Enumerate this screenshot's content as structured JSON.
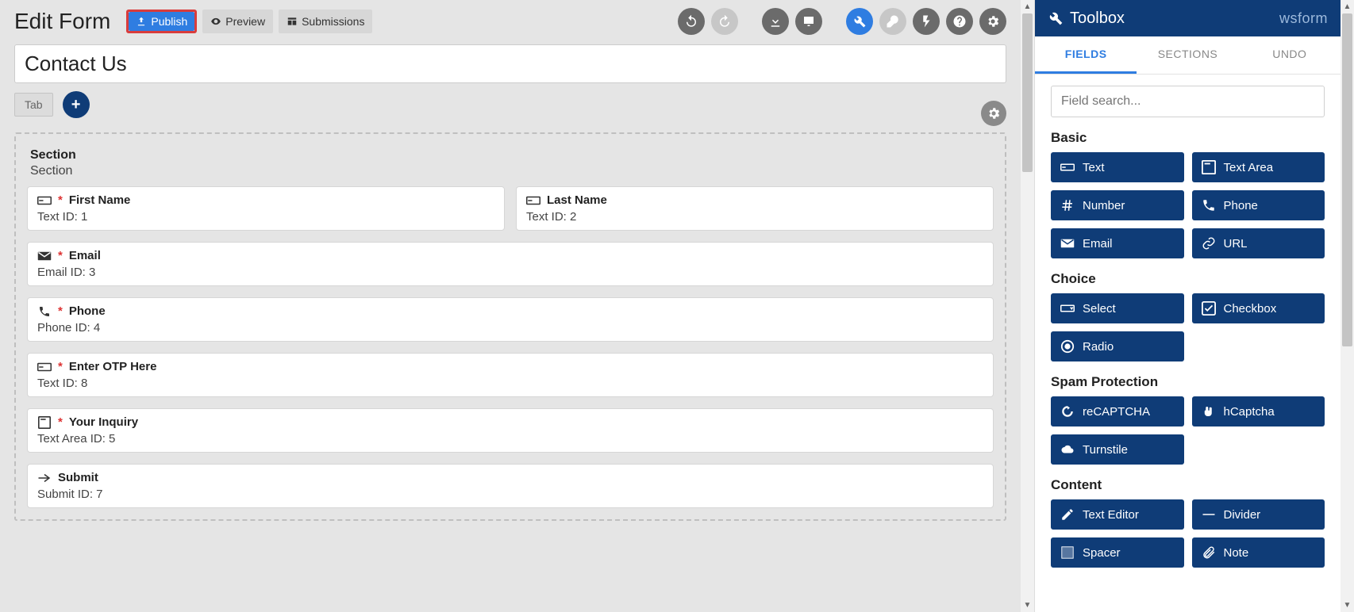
{
  "header": {
    "app_title": "Edit Form",
    "publish": "Publish",
    "preview": "Preview",
    "submissions": "Submissions"
  },
  "form": {
    "title": "Contact Us",
    "tab_label": "Tab",
    "section_title": "Section",
    "section_sub": "Section",
    "fields": [
      {
        "name": "First Name",
        "required": true,
        "meta": "Text  ID: 1",
        "icon": "text"
      },
      {
        "name": "Last Name",
        "required": false,
        "meta": "Text  ID: 2",
        "icon": "text"
      },
      {
        "name": "Email",
        "required": true,
        "meta": "Email  ID: 3",
        "icon": "email"
      },
      {
        "name": "Phone",
        "required": true,
        "meta": "Phone  ID: 4",
        "icon": "phone"
      },
      {
        "name": "Enter OTP Here",
        "required": true,
        "meta": "Text  ID: 8",
        "icon": "text"
      },
      {
        "name": "Your Inquiry",
        "required": true,
        "meta": "Text Area  ID: 5",
        "icon": "textarea"
      },
      {
        "name": "Submit",
        "required": false,
        "meta": "Submit  ID: 7",
        "icon": "submit"
      }
    ]
  },
  "toolbox": {
    "title": "Toolbox",
    "brand": "wsform",
    "tabs": {
      "fields": "FIELDS",
      "sections": "SECTIONS",
      "undo": "UNDO"
    },
    "search_placeholder": "Field search...",
    "groups": {
      "basic": {
        "title": "Basic",
        "items": [
          "Text",
          "Text Area",
          "Number",
          "Phone",
          "Email",
          "URL"
        ]
      },
      "choice": {
        "title": "Choice",
        "items": [
          "Select",
          "Checkbox",
          "Radio"
        ]
      },
      "spam": {
        "title": "Spam Protection",
        "items": [
          "reCAPTCHA",
          "hCaptcha",
          "Turnstile"
        ]
      },
      "content": {
        "title": "Content",
        "items": [
          "Text Editor",
          "Divider",
          "Spacer",
          "Note"
        ]
      }
    }
  }
}
